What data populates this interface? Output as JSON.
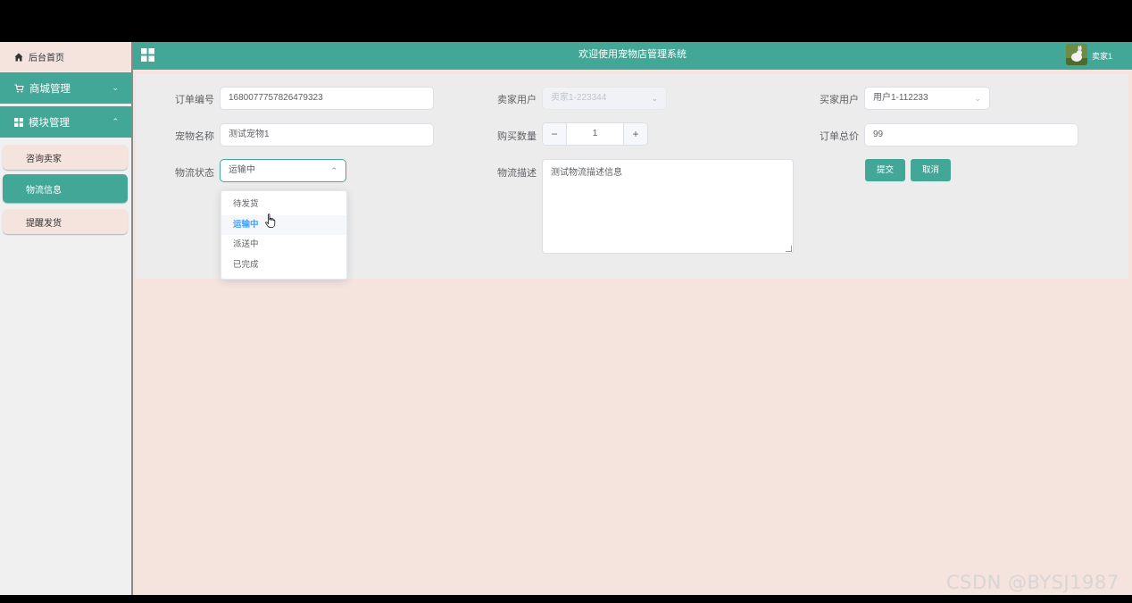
{
  "sidebar": {
    "home": "后台首页",
    "groups": [
      {
        "label": "商城管理",
        "expanded": false
      },
      {
        "label": "模块管理",
        "expanded": true
      }
    ],
    "sub_items": [
      "咨询卖家",
      "物流信息",
      "提醒发货"
    ],
    "active_item": "物流信息"
  },
  "header": {
    "title": "欢迎使用宠物店管理系统",
    "username": "卖家1"
  },
  "form": {
    "order_no_label": "订单编号",
    "order_no_value": "1680077757826479323",
    "seller_label": "卖家用户",
    "seller_value": "卖家1-223344",
    "buyer_label": "买家用户",
    "buyer_value": "用户1-112233",
    "pet_name_label": "宠物名称",
    "pet_name_value": "测试宠物1",
    "qty_label": "购买数量",
    "qty_value": "1",
    "qty_minus": "−",
    "qty_plus": "+",
    "total_label": "订单总价",
    "total_value": "99",
    "status_label": "物流状态",
    "status_value": "运输中",
    "desc_label": "物流描述",
    "desc_value": "测试物流描述信息",
    "submit": "提交",
    "cancel": "取消"
  },
  "status_options": [
    "待发货",
    "运输中",
    "派送中",
    "已完成"
  ],
  "status_selected_index": 1,
  "watermark": "CSDN @BYSJ1987",
  "colors": {
    "primary": "#42a797",
    "background": "#f5e3de",
    "selected_option": "#409eff"
  }
}
